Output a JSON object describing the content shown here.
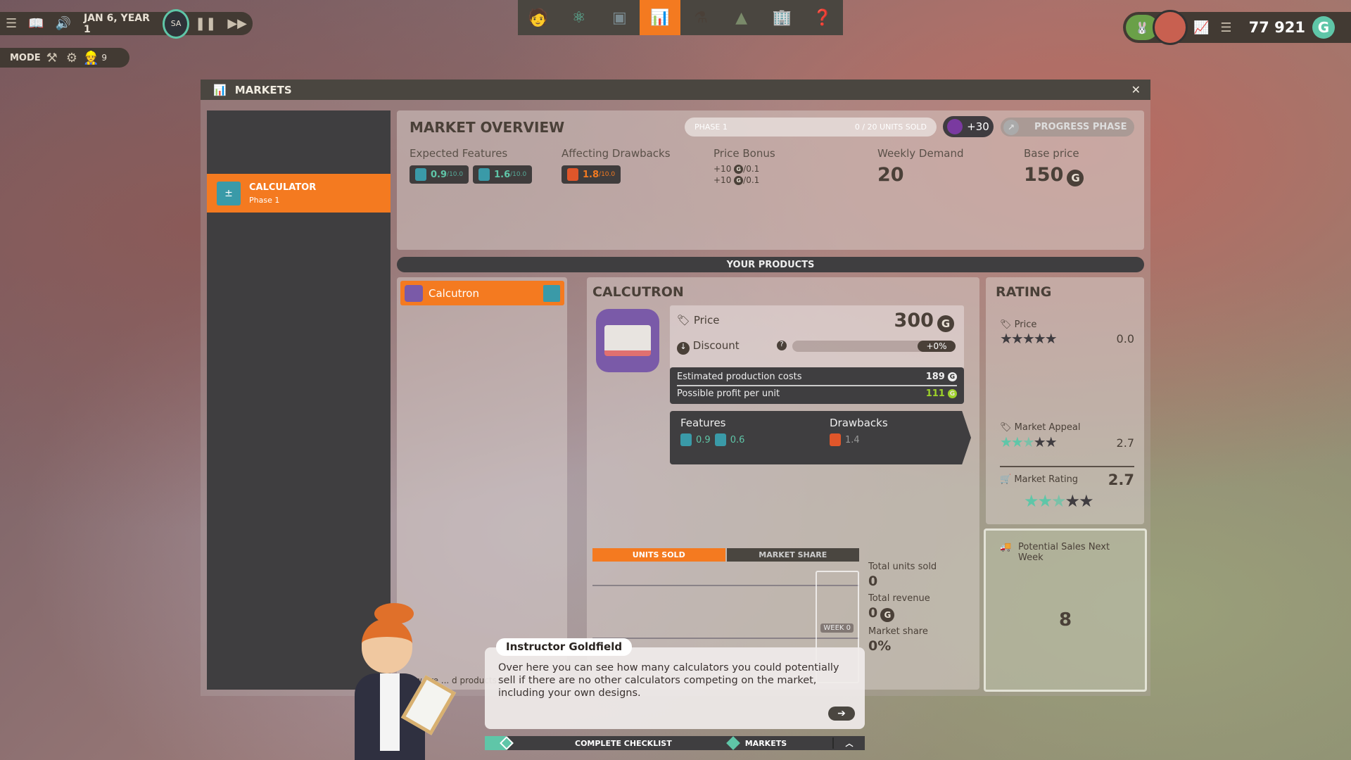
{
  "topbar": {
    "date": "JAN 6, YEAR 1",
    "speed_badge": "SA",
    "mode_label": "MODE",
    "workers": "9",
    "money": "77 921",
    "currency": "G"
  },
  "toolbar": {
    "tabs": [
      "staff",
      "research",
      "products",
      "markets",
      "lab",
      "expansion",
      "buildings",
      "help"
    ],
    "active": "markets"
  },
  "window": {
    "title": "MARKETS",
    "close": "✕"
  },
  "sidebar": {
    "items": [
      {
        "label": "CALCULATOR",
        "sub": "Phase 1"
      }
    ]
  },
  "overview": {
    "title": "MARKET OVERVIEW",
    "phase": "PHASE 1",
    "units_sold": "0 / 20 UNITS SOLD",
    "bonus": "+30",
    "progress_button": "PROGRESS PHASE",
    "expected_features_label": "Expected Features",
    "expected_features": [
      {
        "value": "0.9",
        "max": "/10.0"
      },
      {
        "value": "1.6",
        "max": "/10.0"
      }
    ],
    "drawbacks_label": "Affecting Drawbacks",
    "drawbacks": [
      {
        "value": "1.8",
        "max": "/10.0"
      }
    ],
    "price_bonus_label": "Price Bonus",
    "price_bonus": [
      "+10",
      "+10"
    ],
    "price_bonus_unit": "/0.1",
    "weekly_demand_label": "Weekly Demand",
    "weekly_demand": "20",
    "base_price_label": "Base price",
    "base_price": "150"
  },
  "products": {
    "header": "YOUR PRODUCTS",
    "list": [
      {
        "name": "Calcutron"
      }
    ],
    "hint": "how are ... d products"
  },
  "detail": {
    "title": "CALCUTRON",
    "price_label": "Price",
    "price": "300",
    "discount_label": "Discount",
    "discount": "+0%",
    "discount_fraction": 0,
    "cost_label": "Estimated production costs",
    "cost": "189",
    "profit_label": "Possible profit per unit",
    "profit": "111",
    "features_label": "Features",
    "features": [
      "0.9",
      "0.6"
    ],
    "drawbacks_label": "Drawbacks",
    "drawbacks": [
      "1.4"
    ],
    "tabs": [
      "UNITS SOLD",
      "MARKET SHARE"
    ],
    "active_tab": "UNITS SOLD",
    "week_label": "WEEK 0",
    "total_units_label": "Total units sold",
    "total_units": "0",
    "revenue_label": "Total revenue",
    "revenue": "0",
    "share_label": "Market share",
    "share": "0%"
  },
  "rating": {
    "title": "RATING",
    "price_label": "Price",
    "price_value": "0.0",
    "price_stars": 0,
    "appeal_label": "Market Appeal",
    "appeal_value": "2.7",
    "appeal_stars": 2.7,
    "market_label": "Market Rating",
    "market_value": "2.7",
    "market_stars": 2.7
  },
  "potential": {
    "label": "Potential Sales Next Week",
    "value": "8"
  },
  "tutorial": {
    "speaker": "Instructor Goldfield",
    "text": "Over here you can see how many calculators you could potentially sell if there are no other calculators competing on the market, including your own designs."
  },
  "checklist": {
    "label": "COMPLETE CHECKLIST",
    "current": "MARKETS"
  },
  "colors": {
    "accent": "#f47a20",
    "teal": "#5fc6a8",
    "dark": "#3f3e40",
    "profit": "#9ed22a",
    "drawback": "#e0562a"
  }
}
